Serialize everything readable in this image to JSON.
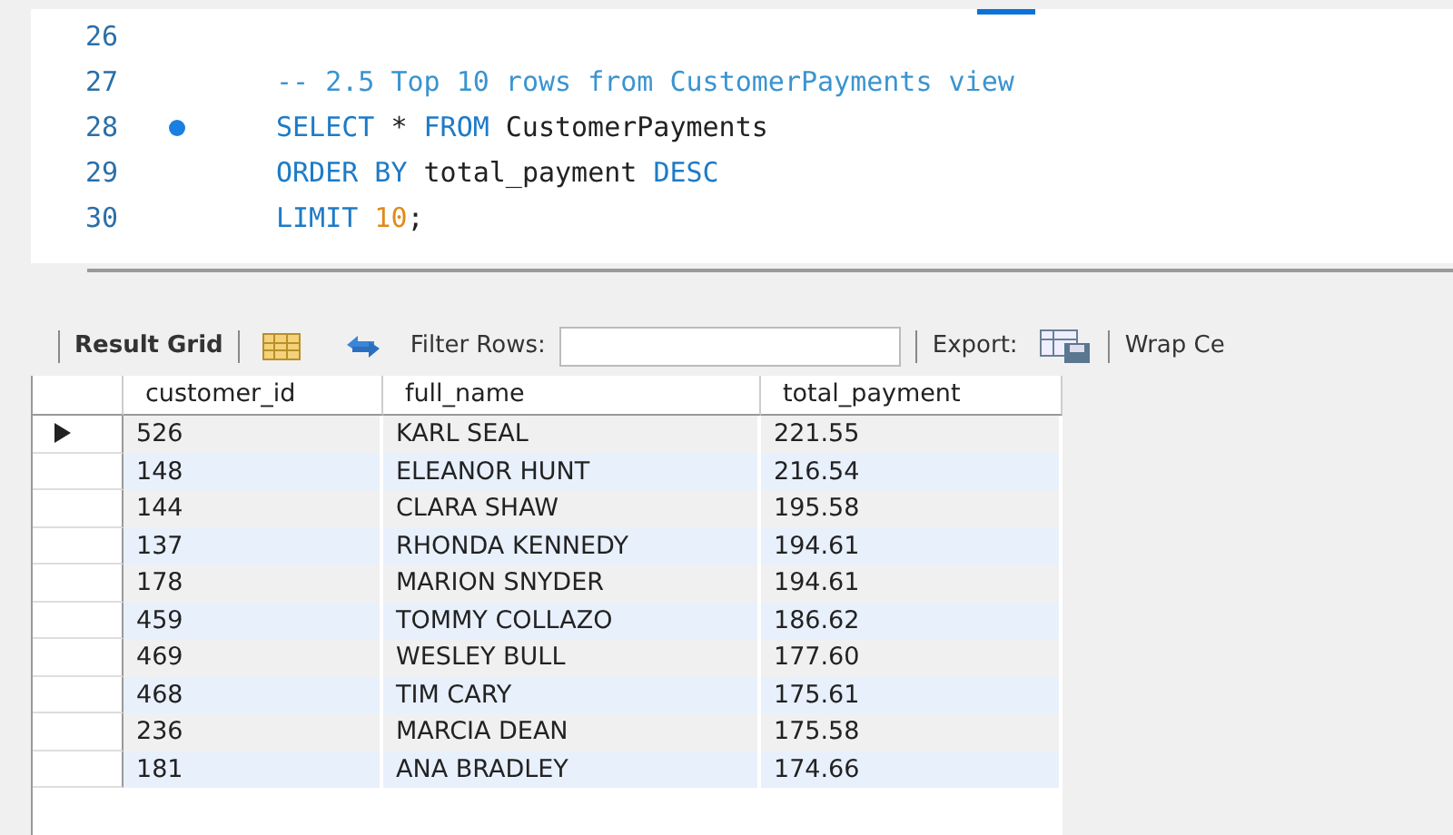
{
  "editor": {
    "lines": [
      {
        "number": "26",
        "breakpoint": false
      },
      {
        "number": "27",
        "breakpoint": false,
        "tokens": [
          {
            "kind": "comment",
            "text": "-- 2.5 Top 10 rows from CustomerPayments view"
          }
        ]
      },
      {
        "number": "28",
        "breakpoint": true,
        "tokens": [
          {
            "kind": "keyword",
            "text": "SELECT"
          },
          {
            "kind": "plain",
            "text": "* "
          },
          {
            "kind": "keyword",
            "text": "FROM"
          },
          {
            "kind": "plain",
            "text": "CustomerPayments"
          }
        ]
      },
      {
        "number": "29",
        "breakpoint": false,
        "tokens": [
          {
            "kind": "keyword",
            "text": "ORDER BY"
          },
          {
            "kind": "plain",
            "text": "total_payment "
          },
          {
            "kind": "keyword",
            "text": "DESC"
          }
        ]
      },
      {
        "number": "30",
        "breakpoint": false,
        "tokens": [
          {
            "kind": "keyword",
            "text": "LIMIT"
          },
          {
            "kind": "number",
            "text": "10"
          },
          {
            "kind": "plain",
            "text": ";"
          }
        ]
      }
    ]
  },
  "toolbar": {
    "result_grid": "Result Grid",
    "filter_label": "Filter Rows:",
    "export_label": "Export:",
    "wrap_label": "Wrap Ce"
  },
  "table": {
    "columns": [
      "customer_id",
      "full_name",
      "total_payment"
    ],
    "rows": [
      {
        "current": true,
        "cells": [
          "526",
          "KARL SEAL",
          "221.55"
        ]
      },
      {
        "current": false,
        "cells": [
          "148",
          "ELEANOR HUNT",
          "216.54"
        ]
      },
      {
        "current": false,
        "cells": [
          "144",
          "CLARA SHAW",
          "195.58"
        ]
      },
      {
        "current": false,
        "cells": [
          "137",
          "RHONDA KENNEDY",
          "194.61"
        ]
      },
      {
        "current": false,
        "cells": [
          "178",
          "MARION SNYDER",
          "194.61"
        ]
      },
      {
        "current": false,
        "cells": [
          "459",
          "TOMMY COLLAZO",
          "186.62"
        ]
      },
      {
        "current": false,
        "cells": [
          "469",
          "WESLEY BULL",
          "177.60"
        ]
      },
      {
        "current": false,
        "cells": [
          "468",
          "TIM CARY",
          "175.61"
        ]
      },
      {
        "current": false,
        "cells": [
          "236",
          "MARCIA DEAN",
          "175.58"
        ]
      },
      {
        "current": false,
        "cells": [
          "181",
          "ANA BRADLEY",
          "174.66"
        ]
      }
    ]
  }
}
